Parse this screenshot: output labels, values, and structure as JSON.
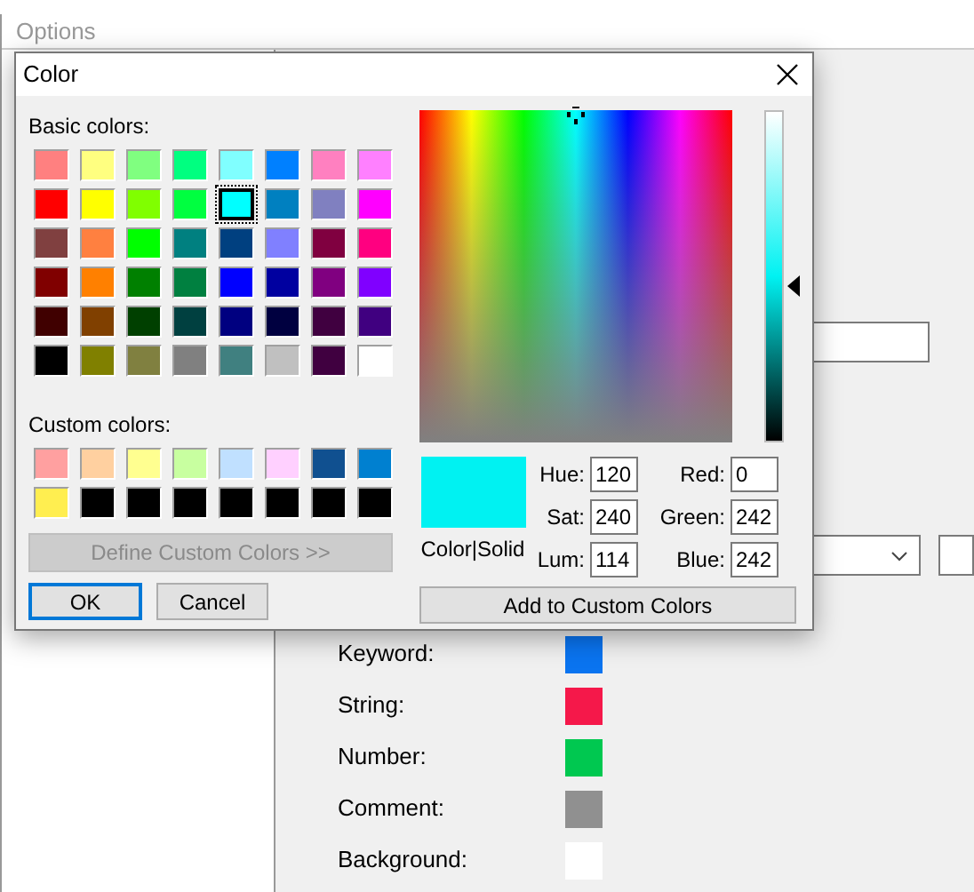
{
  "options_window": {
    "title": "Options",
    "syntax_colors": [
      {
        "label": "Keyword:",
        "color": "#0a74f0"
      },
      {
        "label": "String:",
        "color": "#f5184a"
      },
      {
        "label": "Number:",
        "color": "#00c850"
      },
      {
        "label": "Comment:",
        "color": "#909090"
      },
      {
        "label": "Background:",
        "color": "#ffffff"
      }
    ]
  },
  "color_dialog": {
    "title": "Color",
    "basic_colors": {
      "label": "Basic colors:",
      "swatches": [
        {
          "color": "#ff8080",
          "selected": false
        },
        {
          "color": "#ffff80",
          "selected": false
        },
        {
          "color": "#80ff80",
          "selected": false
        },
        {
          "color": "#00ff80",
          "selected": false
        },
        {
          "color": "#80ffff",
          "selected": false
        },
        {
          "color": "#0080ff",
          "selected": false
        },
        {
          "color": "#ff80c0",
          "selected": false
        },
        {
          "color": "#ff80ff",
          "selected": false
        },
        {
          "color": "#ff0000",
          "selected": false
        },
        {
          "color": "#ffff00",
          "selected": false
        },
        {
          "color": "#80ff00",
          "selected": false
        },
        {
          "color": "#00ff40",
          "selected": false
        },
        {
          "color": "#00ffff",
          "selected": true
        },
        {
          "color": "#0080c0",
          "selected": false
        },
        {
          "color": "#8080c0",
          "selected": false
        },
        {
          "color": "#ff00ff",
          "selected": false
        },
        {
          "color": "#804040",
          "selected": false
        },
        {
          "color": "#ff8040",
          "selected": false
        },
        {
          "color": "#00ff00",
          "selected": false
        },
        {
          "color": "#008080",
          "selected": false
        },
        {
          "color": "#004080",
          "selected": false
        },
        {
          "color": "#8080ff",
          "selected": false
        },
        {
          "color": "#800040",
          "selected": false
        },
        {
          "color": "#ff0080",
          "selected": false
        },
        {
          "color": "#800000",
          "selected": false
        },
        {
          "color": "#ff8000",
          "selected": false
        },
        {
          "color": "#008000",
          "selected": false
        },
        {
          "color": "#008040",
          "selected": false
        },
        {
          "color": "#0000ff",
          "selected": false
        },
        {
          "color": "#0000a0",
          "selected": false
        },
        {
          "color": "#800080",
          "selected": false
        },
        {
          "color": "#8000ff",
          "selected": false
        },
        {
          "color": "#400000",
          "selected": false
        },
        {
          "color": "#804000",
          "selected": false
        },
        {
          "color": "#004000",
          "selected": false
        },
        {
          "color": "#004040",
          "selected": false
        },
        {
          "color": "#000080",
          "selected": false
        },
        {
          "color": "#000040",
          "selected": false
        },
        {
          "color": "#400040",
          "selected": false
        },
        {
          "color": "#400080",
          "selected": false
        },
        {
          "color": "#000000",
          "selected": false
        },
        {
          "color": "#808000",
          "selected": false
        },
        {
          "color": "#808040",
          "selected": false
        },
        {
          "color": "#808080",
          "selected": false
        },
        {
          "color": "#408080",
          "selected": false
        },
        {
          "color": "#c0c0c0",
          "selected": false
        },
        {
          "color": "#400040",
          "selected": false
        },
        {
          "color": "#ffffff",
          "selected": false
        }
      ]
    },
    "custom_colors": {
      "label": "Custom colors:",
      "swatches": [
        {
          "color": "#ffa0a0"
        },
        {
          "color": "#ffd0a0"
        },
        {
          "color": "#ffff90"
        },
        {
          "color": "#c8ffa0"
        },
        {
          "color": "#c0e0ff"
        },
        {
          "color": "#ffd0ff"
        },
        {
          "color": "#105090"
        },
        {
          "color": "#0080d0"
        },
        {
          "color": "#ffee50"
        },
        {
          "color": "#000000"
        },
        {
          "color": "#000000"
        },
        {
          "color": "#000000"
        },
        {
          "color": "#000000"
        },
        {
          "color": "#000000"
        },
        {
          "color": "#000000"
        },
        {
          "color": "#000000"
        }
      ]
    },
    "define_button": {
      "label": "Define Custom Colors >>",
      "disabled": true
    },
    "ok_button": {
      "label": "OK"
    },
    "cancel_button": {
      "label": "Cancel"
    },
    "lum_slider": {
      "level": 0.475
    },
    "preview_label": {
      "label": "Color|Solid"
    },
    "hsl_fields": [
      {
        "label": "Hue:",
        "value": "120"
      },
      {
        "label": "Sat:",
        "value": "240"
      },
      {
        "label": "Lum:",
        "value": "114"
      }
    ],
    "rgb_fields": [
      {
        "label": "Red:",
        "value": "0"
      },
      {
        "label": "Green:",
        "value": "242"
      },
      {
        "label": "Blue:",
        "value": "242"
      }
    ],
    "add_button": {
      "label": "Add to Custom Colors"
    }
  }
}
